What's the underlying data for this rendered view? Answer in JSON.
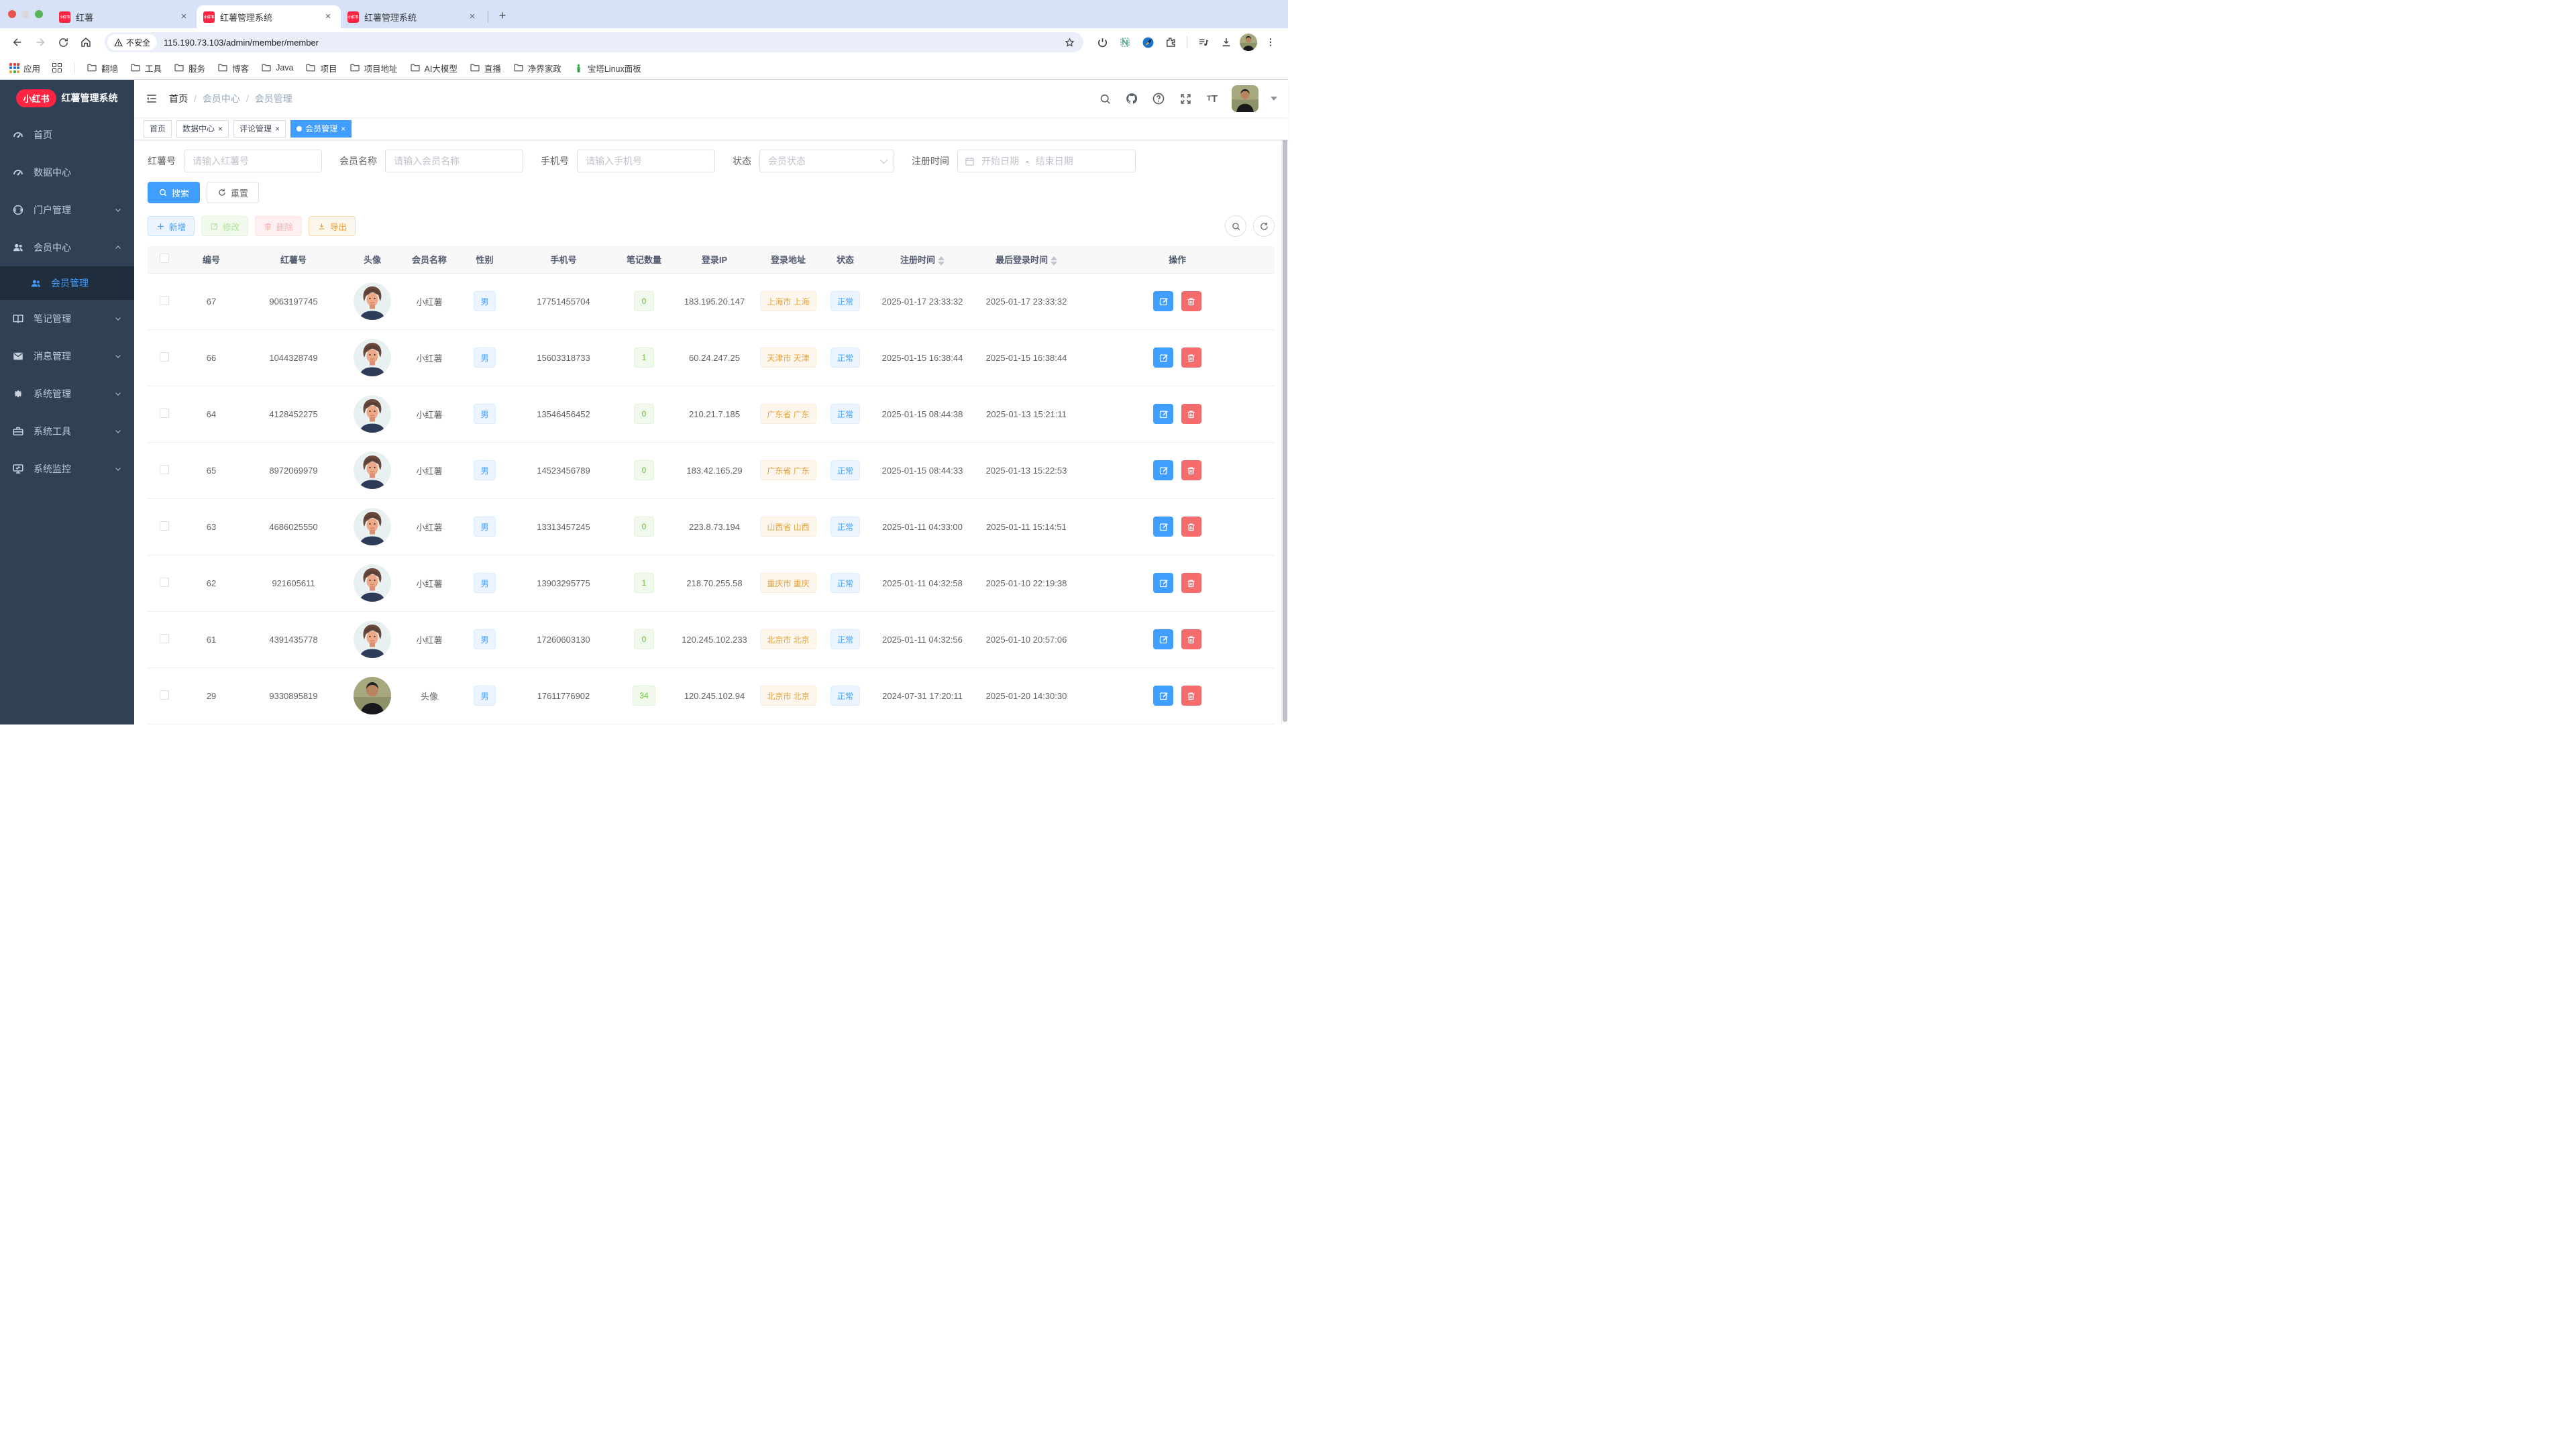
{
  "browser": {
    "tabs": [
      {
        "title": "红薯",
        "active": false
      },
      {
        "title": "红薯管理系统",
        "active": true
      },
      {
        "title": "红薯管理系统",
        "active": false
      }
    ],
    "favicon_text": "小红书",
    "close_glyph": "×",
    "new_tab_glyph": "+",
    "security_label": "不安全",
    "url": "115.190.73.103/admin/member/member",
    "bookmarks": {
      "apps_label": "应用",
      "folders": [
        "翻墙",
        "工具",
        "服务",
        "博客",
        "Java",
        "项目",
        "项目地址",
        "AI大模型",
        "直播",
        "净界家政"
      ],
      "last_item": "宝塔Linux面板"
    }
  },
  "sidebar": {
    "logo_badge": "小红书",
    "title": "红薯管理系统",
    "items": [
      {
        "label": "首页",
        "icon": "dashboard-icon"
      },
      {
        "label": "数据中心",
        "icon": "data-center-icon"
      },
      {
        "label": "门户管理",
        "icon": "portal-icon",
        "expandable": true
      },
      {
        "label": "会员中心",
        "icon": "users-icon",
        "expandable": true,
        "expanded": true,
        "children": [
          {
            "label": "会员管理",
            "icon": "member-icon",
            "active": true
          }
        ]
      },
      {
        "label": "笔记管理",
        "icon": "notebook-icon",
        "expandable": true
      },
      {
        "label": "消息管理",
        "icon": "message-icon",
        "expandable": true
      },
      {
        "label": "系统管理",
        "icon": "gear-icon",
        "expandable": true
      },
      {
        "label": "系统工具",
        "icon": "toolbox-icon",
        "expandable": true
      },
      {
        "label": "系统监控",
        "icon": "monitor-icon",
        "expandable": true
      }
    ]
  },
  "header": {
    "breadcrumb": [
      "首页",
      "会员中心",
      "会员管理"
    ],
    "separator": "/"
  },
  "tags": [
    {
      "label": "首页",
      "closable": false,
      "active": false
    },
    {
      "label": "数据中心",
      "closable": true,
      "active": false
    },
    {
      "label": "评论管理",
      "closable": true,
      "active": false
    },
    {
      "label": "会员管理",
      "closable": true,
      "active": true
    }
  ],
  "filters": {
    "redid": {
      "label": "红薯号",
      "placeholder": "请输入红薯号"
    },
    "name": {
      "label": "会员名称",
      "placeholder": "请输入会员名称"
    },
    "phone": {
      "label": "手机号",
      "placeholder": "请输入手机号"
    },
    "status": {
      "label": "状态",
      "placeholder": "会员状态"
    },
    "regtime": {
      "label": "注册时间",
      "start_placeholder": "开始日期",
      "separator": "-",
      "end_placeholder": "结束日期"
    },
    "search_label": "搜索",
    "reset_label": "重置"
  },
  "toolbar": {
    "add_label": "新增",
    "edit_label": "修改",
    "delete_label": "删除",
    "export_label": "导出"
  },
  "table": {
    "columns": [
      "编号",
      "红薯号",
      "头像",
      "会员名称",
      "性别",
      "手机号",
      "笔记数量",
      "登录IP",
      "登录地址",
      "状态",
      "注册时间",
      "最后登录时间",
      "操作"
    ],
    "rows": [
      {
        "id": "67",
        "uid": "9063197745",
        "avatar": "cartoon",
        "name": "小红薯",
        "gender": "男",
        "phone": "17751455704",
        "notes": "0",
        "ip": "183.195.20.147",
        "addr": "上海市 上海",
        "status": "正常",
        "reg": "2025-01-17 23:33:32",
        "last": "2025-01-17 23:33:32"
      },
      {
        "id": "66",
        "uid": "1044328749",
        "avatar": "cartoon",
        "name": "小红薯",
        "gender": "男",
        "phone": "15603318733",
        "notes": "1",
        "ip": "60.24.247.25",
        "addr": "天津市 天津",
        "status": "正常",
        "reg": "2025-01-15 16:38:44",
        "last": "2025-01-15 16:38:44"
      },
      {
        "id": "64",
        "uid": "4128452275",
        "avatar": "cartoon",
        "name": "小红薯",
        "gender": "男",
        "phone": "13546456452",
        "notes": "0",
        "ip": "210.21.7.185",
        "addr": "广东省 广东",
        "status": "正常",
        "reg": "2025-01-15 08:44:38",
        "last": "2025-01-13 15:21:11"
      },
      {
        "id": "65",
        "uid": "8972069979",
        "avatar": "cartoon",
        "name": "小红薯",
        "gender": "男",
        "phone": "14523456789",
        "notes": "0",
        "ip": "183.42.165.29",
        "addr": "广东省 广东",
        "status": "正常",
        "reg": "2025-01-15 08:44:33",
        "last": "2025-01-13 15:22:53"
      },
      {
        "id": "63",
        "uid": "4686025550",
        "avatar": "cartoon",
        "name": "小红薯",
        "gender": "男",
        "phone": "13313457245",
        "notes": "0",
        "ip": "223.8.73.194",
        "addr": "山西省 山西",
        "status": "正常",
        "reg": "2025-01-11 04:33:00",
        "last": "2025-01-11 15:14:51"
      },
      {
        "id": "62",
        "uid": "921605611",
        "avatar": "cartoon",
        "name": "小红薯",
        "gender": "男",
        "phone": "13903295775",
        "notes": "1",
        "ip": "218.70.255.58",
        "addr": "重庆市 重庆",
        "status": "正常",
        "reg": "2025-01-11 04:32:58",
        "last": "2025-01-10 22:19:38"
      },
      {
        "id": "61",
        "uid": "4391435778",
        "avatar": "cartoon",
        "name": "小红薯",
        "gender": "男",
        "phone": "17260603130",
        "notes": "0",
        "ip": "120.245.102.233",
        "addr": "北京市 北京",
        "status": "正常",
        "reg": "2025-01-11 04:32:56",
        "last": "2025-01-10 20:57:06"
      },
      {
        "id": "29",
        "uid": "9330895819",
        "avatar": "photo",
        "name": "头像",
        "gender": "男",
        "phone": "17611776902",
        "notes": "34",
        "ip": "120.245.102.94",
        "addr": "北京市 北京",
        "status": "正常",
        "reg": "2024-07-31 17:20:11",
        "last": "2025-01-20 14:30:30"
      }
    ]
  }
}
